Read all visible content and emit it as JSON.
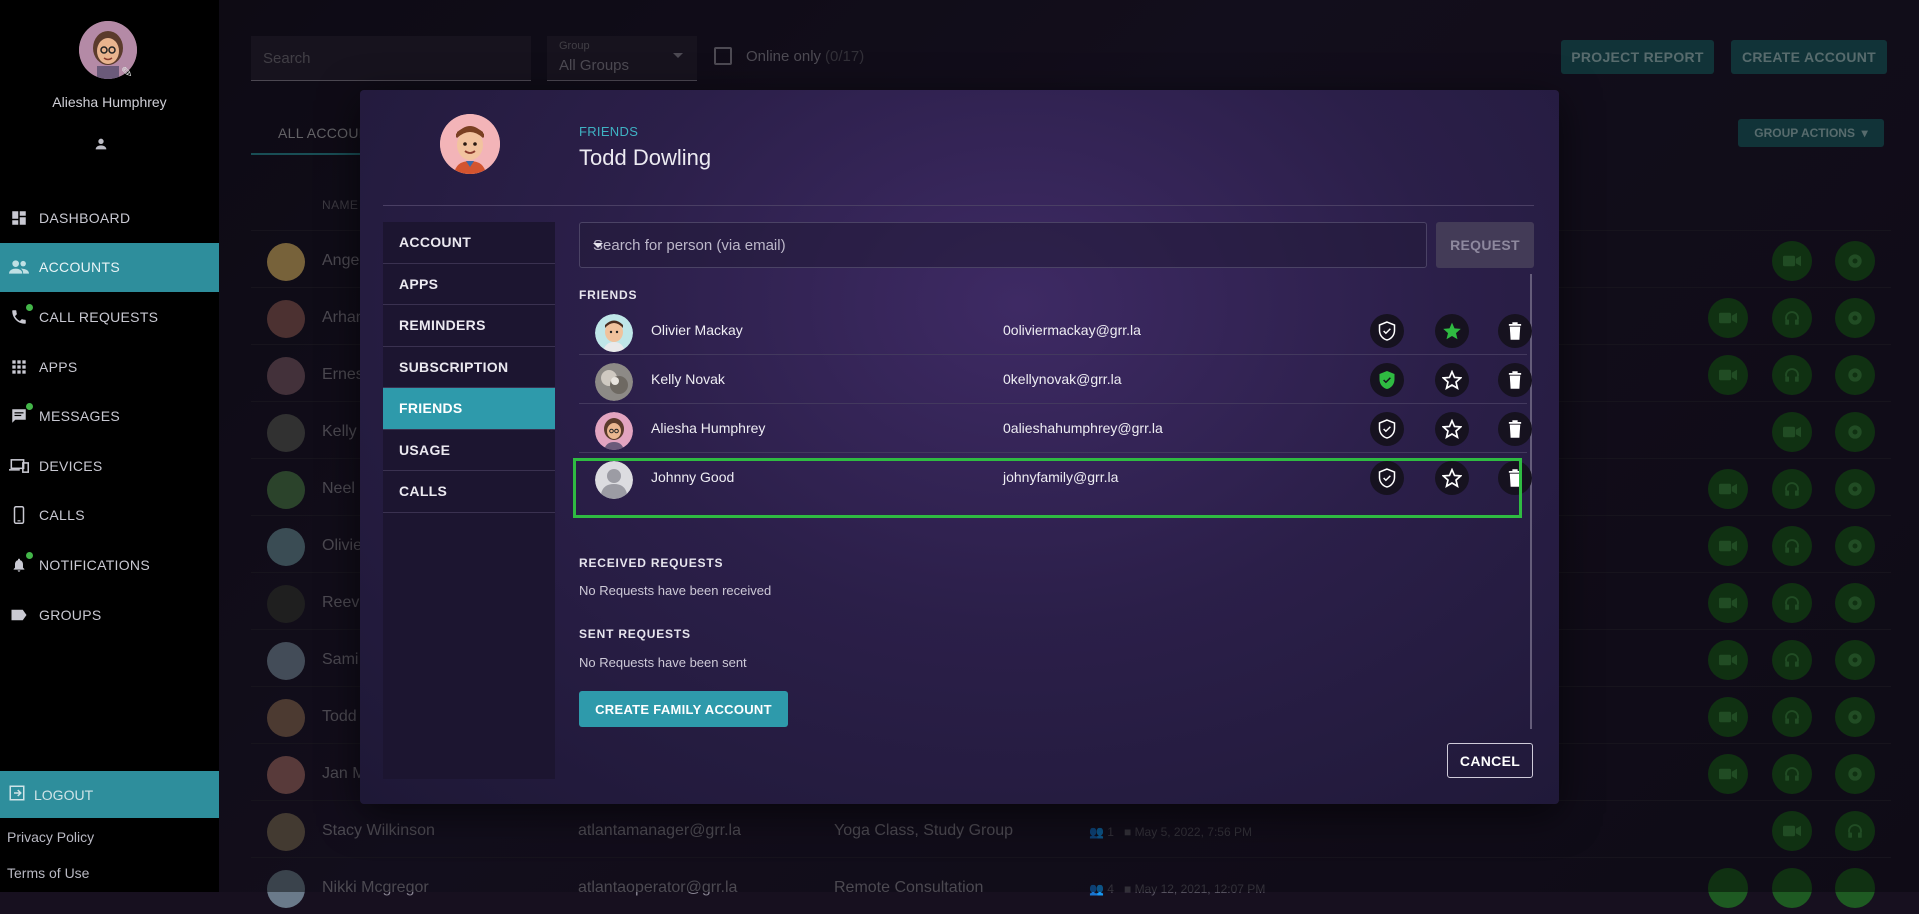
{
  "sidebar": {
    "user_name": "Aliesha Humphrey",
    "nav": [
      {
        "label": "DASHBOARD",
        "icon": "dashboard-icon"
      },
      {
        "label": "ACCOUNTS",
        "icon": "accounts-icon",
        "active": true
      },
      {
        "label": "CALL REQUESTS",
        "icon": "phone-icon",
        "dot": true
      },
      {
        "label": "APPS",
        "icon": "apps-grid-icon"
      },
      {
        "label": "MESSAGES",
        "icon": "message-icon",
        "dot": true
      },
      {
        "label": "DEVICES",
        "icon": "devices-icon"
      },
      {
        "label": "CALLS",
        "icon": "mobile-icon"
      },
      {
        "label": "NOTIFICATIONS",
        "icon": "bell-icon",
        "dot": true
      },
      {
        "label": "GROUPS",
        "icon": "label-icon"
      }
    ],
    "logout": "LOGOUT",
    "privacy": "Privacy Policy",
    "terms": "Terms of Use"
  },
  "toolbar": {
    "search_placeholder": "Search",
    "group_label": "Group",
    "group_value": "All Groups",
    "online_label": "Online only",
    "online_count": "(0/17)",
    "project_report": "PROJECT REPORT",
    "create_account": "CREATE ACCOUNT",
    "tab_all": "ALL ACCOUNTS",
    "group_actions": "GROUP ACTIONS",
    "col_name": "NAME"
  },
  "bg_rows": [
    {
      "name": "Ange"
    },
    {
      "name": "Arhan"
    },
    {
      "name": "Ernes"
    },
    {
      "name": "Kelly"
    },
    {
      "name": "Neel"
    },
    {
      "name": "Olivie"
    },
    {
      "name": "Reev"
    },
    {
      "name": "Sami"
    },
    {
      "name": "Todd"
    },
    {
      "name": "Jan M"
    },
    {
      "name": "Stacy Wilkinson",
      "email": "atlantamanager@grr.la",
      "groups": "Yoga Class, Study Group",
      "count": "1",
      "date": "May 5, 2022, 7:56 PM"
    },
    {
      "name": "Nikki Mcgregor",
      "email": "atlantaoperator@grr.la",
      "groups": "Remote Consultation",
      "count": "4",
      "date": "May 12, 2021, 12:07 PM"
    }
  ],
  "dialog": {
    "subtitle": "FRIENDS",
    "title": "Todd Dowling",
    "menu": [
      "ACCOUNT",
      "APPS",
      "REMINDERS",
      "SUBSCRIPTION",
      "FRIENDS",
      "USAGE",
      "CALLS"
    ],
    "active_menu": "FRIENDS",
    "search_placeholder": "Search for person (via email)",
    "request_button": "REQUEST",
    "friends_heading": "FRIENDS",
    "friends": [
      {
        "name": "Olivier Mackay",
        "email": "0oliviermackay@grr.la",
        "shield_active": false,
        "star_active": true
      },
      {
        "name": "Kelly Novak",
        "email": "0kellynovak@grr.la",
        "shield_active": true,
        "star_active": false
      },
      {
        "name": "Aliesha Humphrey",
        "email": "0alieshahumphrey@grr.la",
        "shield_active": false,
        "star_active": false
      },
      {
        "name": "Johnny Good",
        "email": "johnyfamily@grr.la",
        "shield_active": false,
        "star_active": false
      }
    ],
    "received_heading": "RECEIVED REQUESTS",
    "received_note": "No Requests have been received",
    "sent_heading": "SENT REQUESTS",
    "sent_note": "No Requests have been sent",
    "create_family": "CREATE FAMILY ACCOUNT",
    "cancel": "CANCEL"
  },
  "colors": {
    "accent": "#2e9aab",
    "active_green": "#2fbb42",
    "sidebar_bg": "#000000"
  }
}
